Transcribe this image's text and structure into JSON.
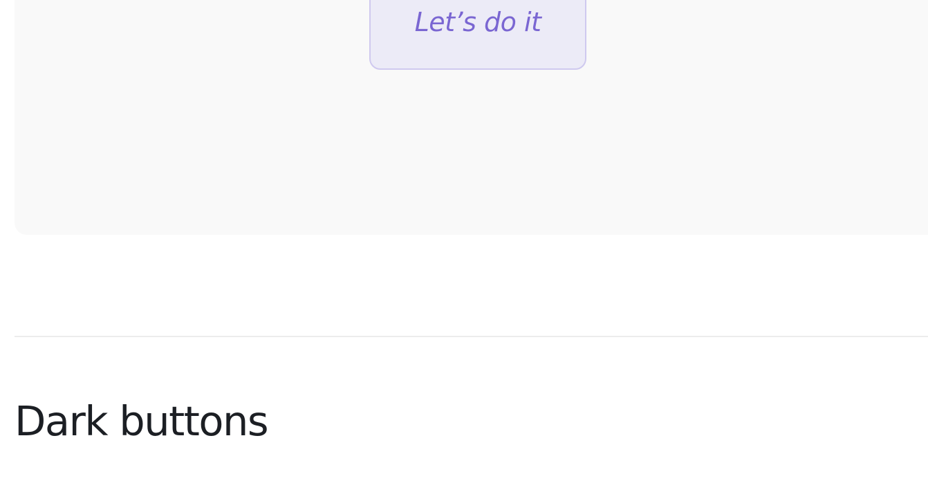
{
  "preview": {
    "button_label": "Let’s do it"
  },
  "section": {
    "heading": "Dark buttons"
  }
}
